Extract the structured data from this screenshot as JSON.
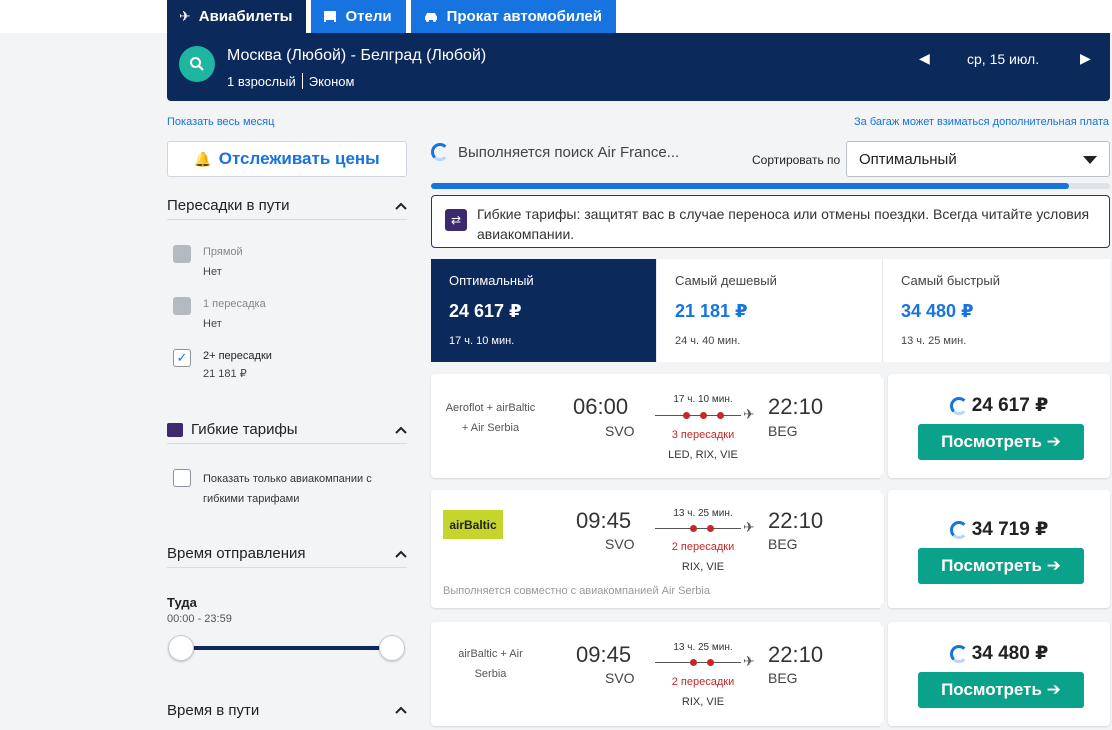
{
  "tabs": [
    {
      "label": "Авиабилеты",
      "icon": "plane-icon"
    },
    {
      "label": "Отели",
      "icon": "bed-icon"
    },
    {
      "label": "Прокат автомобилей",
      "icon": "car-icon"
    }
  ],
  "search": {
    "route": "Москва (Любой) - Белград (Любой)",
    "passengers": "1 взрослый",
    "cabin": "Эконом",
    "date": "ср, 15 июл."
  },
  "links": {
    "whole_month": "Показать весь месяц",
    "baggage": "За багаж может взиматься дополнительная плата"
  },
  "track_prices": "Отслеживать цены",
  "filters": {
    "stops": {
      "title": "Пересадки в пути",
      "items": [
        {
          "label": "Прямой",
          "sub": "Нет",
          "state": "disabled"
        },
        {
          "label": "1 пересадка",
          "sub": "Нет",
          "state": "disabled"
        },
        {
          "label": "2+ пересадки",
          "sub": "21 181 ₽",
          "state": "checked"
        }
      ]
    },
    "flex": {
      "title": "Гибкие тарифы",
      "option": "Показать только авиакомпании с гибкими тарифами"
    },
    "departure": {
      "title": "Время отправления",
      "direction": "Туда",
      "range": "00:00 - 23:59",
      "min": 0,
      "max": 1
    },
    "duration": {
      "title": "Время в пути"
    }
  },
  "loading_text": "Выполняется поиск Air France...",
  "sort": {
    "label": "Сортировать по",
    "value": "Оптимальный"
  },
  "progress": 0.94,
  "notice": "Гибкие тарифы: защитят вас в случае переноса или отмены поездки. Всегда читайте условия авиакомпании.",
  "sort_tabs": [
    {
      "label": "Оптимальный",
      "price": "24 617 ₽",
      "duration": "17 ч. 10 мин.",
      "active": true
    },
    {
      "label": "Самый дешевый",
      "price": "21 181 ₽",
      "duration": "24 ч. 40 мин.",
      "active": false
    },
    {
      "label": "Самый быстрый",
      "price": "34 480 ₽",
      "duration": "13 ч. 25 мин.",
      "active": false
    }
  ],
  "results": [
    {
      "airline": "Aeroflot + airBaltic + Air Serbia",
      "depart_time": "06:00",
      "depart_code": "SVO",
      "arrive_time": "22:10",
      "arrive_code": "BEG",
      "duration": "17 ч. 10 мин.",
      "stops": "3 пересадки",
      "via": "LED, RIX, VIE",
      "price": "24 617 ₽",
      "button": "Посмотреть ➔"
    },
    {
      "airline_logo": "airBaltic",
      "depart_time": "09:45",
      "depart_code": "SVO",
      "arrive_time": "22:10",
      "arrive_code": "BEG",
      "duration": "13 ч. 25 мин.",
      "stops": "2 пересадки",
      "via": "RIX, VIE",
      "operated": "Выполняется совместно с авиакомпанией Air Serbia",
      "price": "34 719 ₽",
      "button": "Посмотреть ➔"
    },
    {
      "airline": "airBaltic + Air Serbia",
      "depart_time": "09:45",
      "depart_code": "SVO",
      "arrive_time": "22:10",
      "arrive_code": "BEG",
      "duration": "13 ч. 25 мин.",
      "stops": "2 пересадки",
      "via": "RIX, VIE",
      "price": "34 480 ₽",
      "button": "Посмотреть ➔"
    }
  ],
  "colors": {
    "navy": "#0b2a5b",
    "blue": "#1673e0",
    "teal": "#0aa28b",
    "red": "#c62828"
  }
}
